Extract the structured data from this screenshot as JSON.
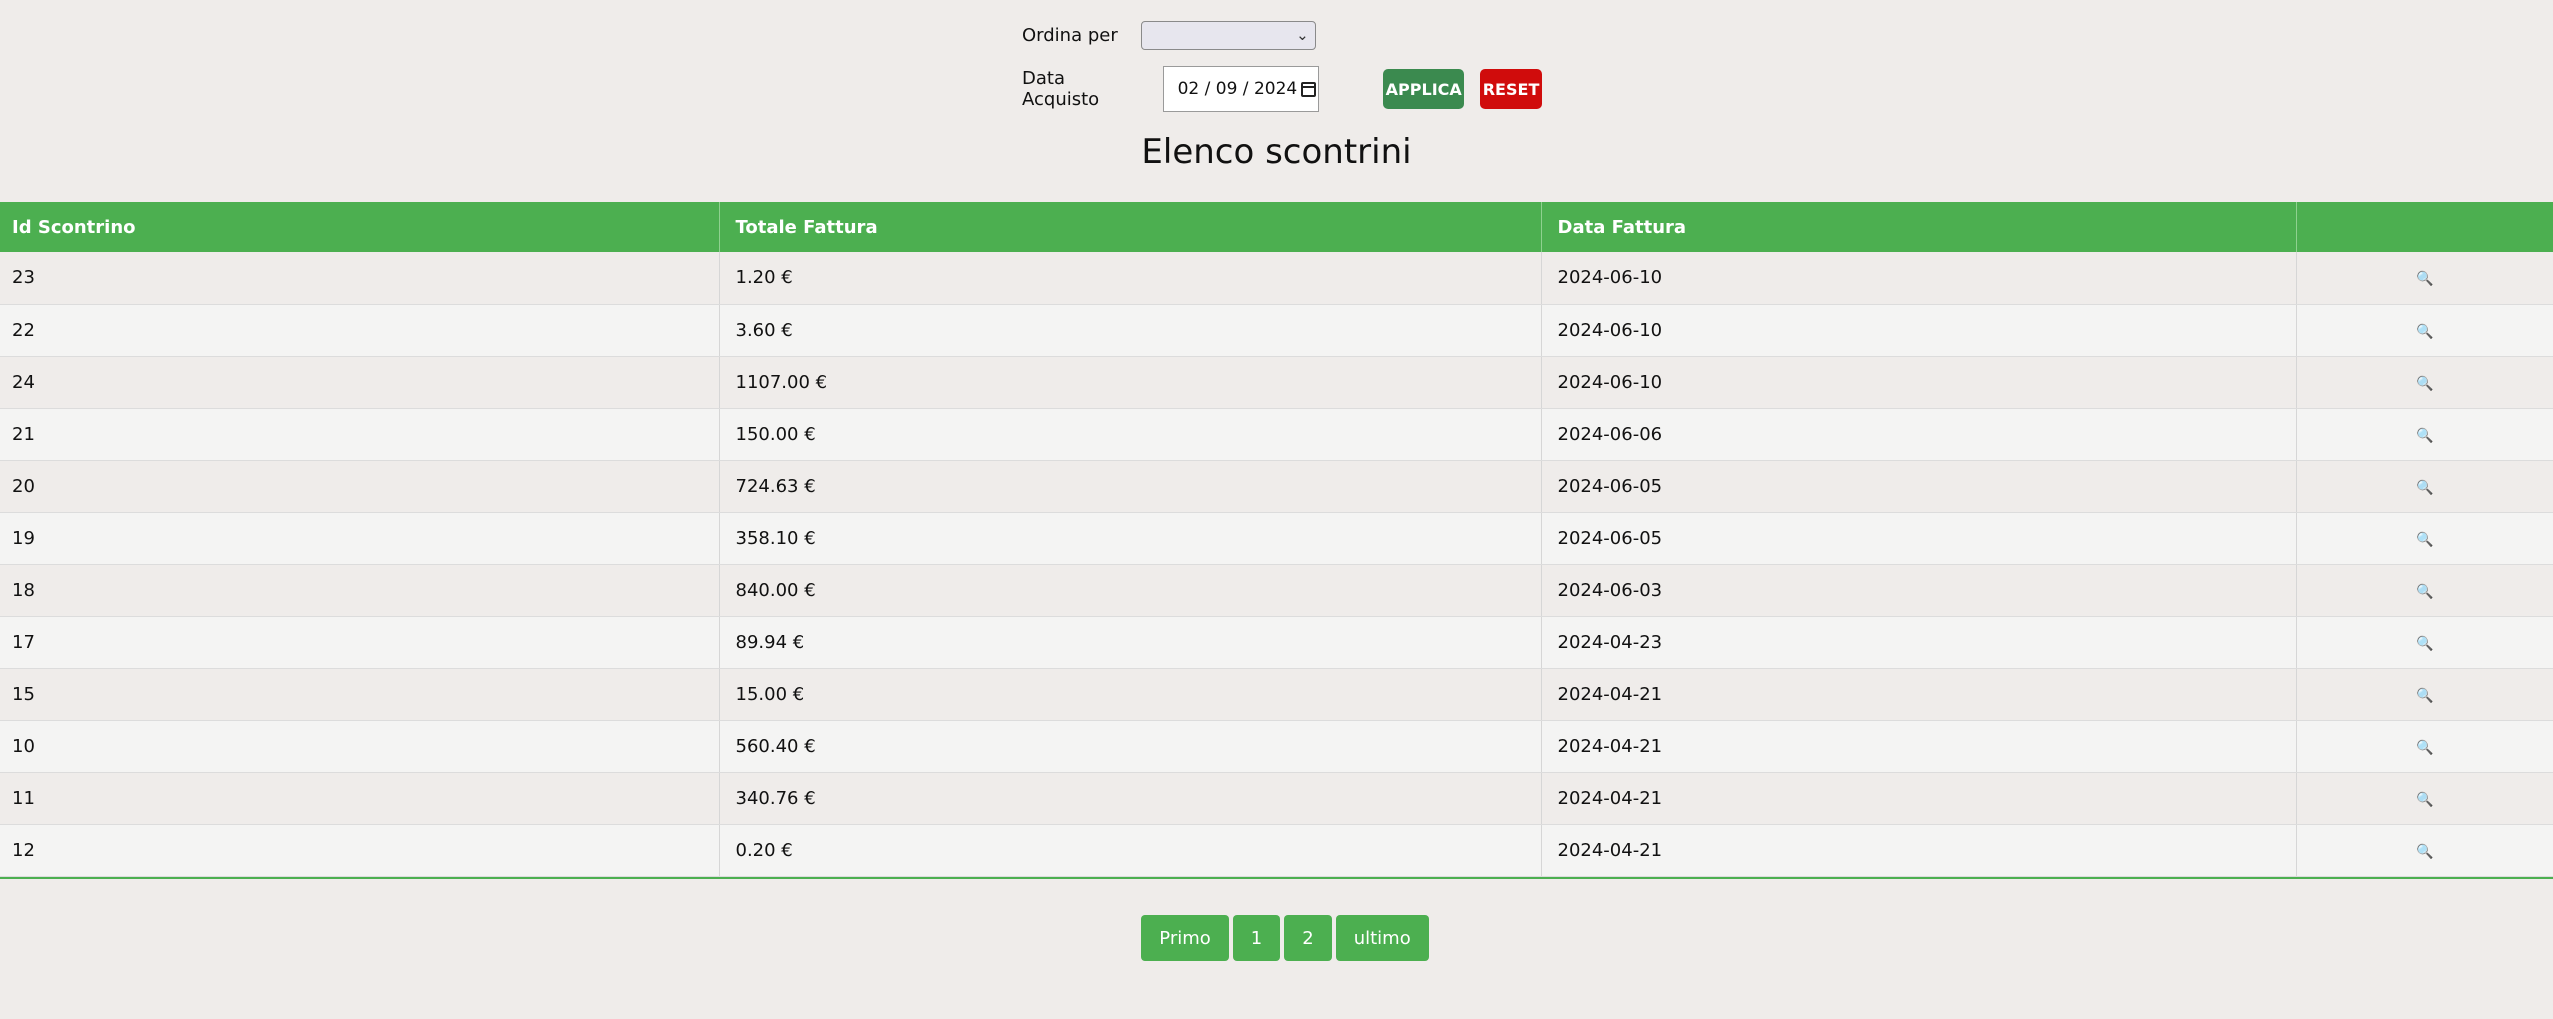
{
  "filters": {
    "order_label": "Ordina per",
    "order_value": "",
    "date_label": "Data Acquisto",
    "date_value": "02 / 09 / 2024",
    "apply_label": "APPLICA",
    "reset_label": "RESET"
  },
  "title": "Elenco scontrini",
  "table": {
    "columns": [
      "Id Scontrino",
      "Totale Fattura",
      "Data Fattura",
      ""
    ],
    "rows": [
      [
        "23",
        "1.20 €",
        "2024-06-10"
      ],
      [
        "22",
        "3.60 €",
        "2024-06-10"
      ],
      [
        "24",
        "1107.00 €",
        "2024-06-10"
      ],
      [
        "21",
        "150.00 €",
        "2024-06-06"
      ],
      [
        "20",
        "724.63 €",
        "2024-06-05"
      ],
      [
        "19",
        "358.10 €",
        "2024-06-05"
      ],
      [
        "18",
        "840.00 €",
        "2024-06-03"
      ],
      [
        "17",
        "89.94 €",
        "2024-04-23"
      ],
      [
        "15",
        "15.00 €",
        "2024-04-21"
      ],
      [
        "10",
        "560.40 €",
        "2024-04-21"
      ],
      [
        "11",
        "340.76 €",
        "2024-04-21"
      ],
      [
        "12",
        "0.20 €",
        "2024-04-21"
      ]
    ],
    "action_icon": "search-icon"
  },
  "pagination": {
    "first": "Primo",
    "pages": [
      "1",
      "2"
    ],
    "last": "ultimo"
  },
  "colors": {
    "accent": "#4caf50",
    "apply": "#3b8a4f",
    "reset": "#d00c0c"
  }
}
